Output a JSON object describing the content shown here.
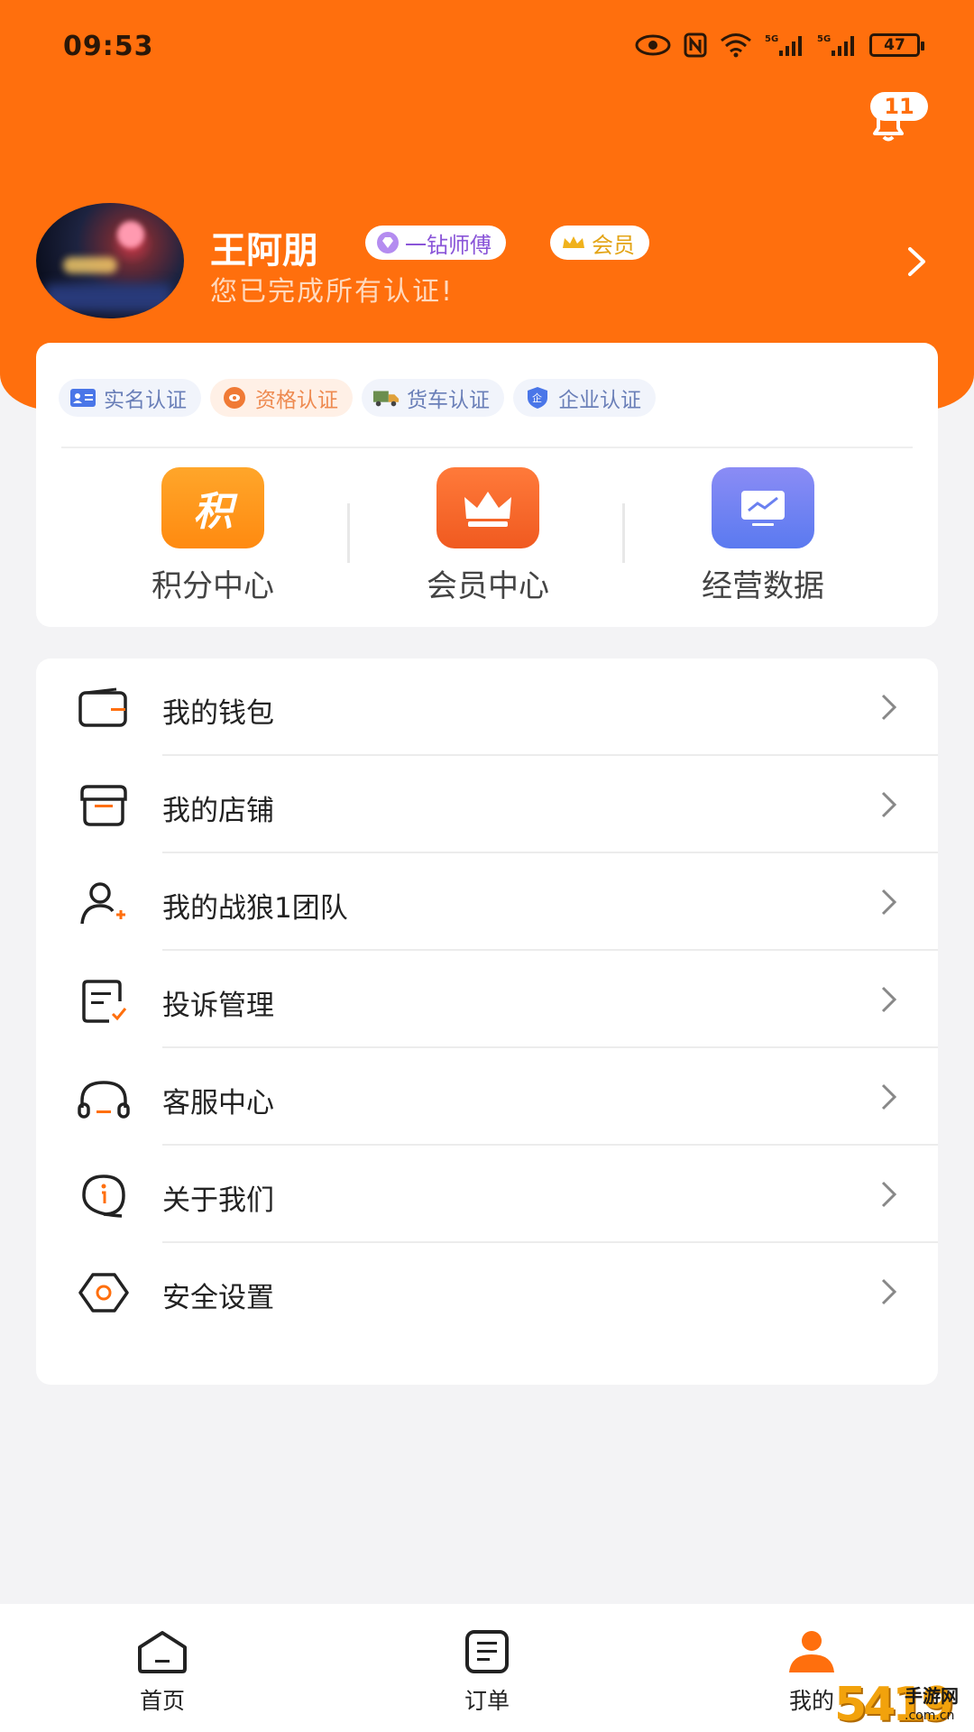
{
  "status_bar": {
    "time": "09:53",
    "network_label": "5G",
    "battery": "47"
  },
  "notifications": {
    "count": "11"
  },
  "profile": {
    "name": "王阿朋",
    "tags": [
      "一钻师傅",
      "会员"
    ],
    "subtitle": "您已完成所有认证!"
  },
  "certifications": [
    {
      "label": "实名认证",
      "icon": "id-card-icon",
      "active": false
    },
    {
      "label": "资格认证",
      "icon": "qualification-icon",
      "active": true
    },
    {
      "label": "货车认证",
      "icon": "truck-icon",
      "active": false
    },
    {
      "label": "企业认证",
      "icon": "enterprise-shield-icon",
      "active": false
    }
  ],
  "quick_entries": [
    {
      "label": "积分中心",
      "icon_text": "积",
      "icon": "points-icon"
    },
    {
      "label": "会员中心",
      "icon": "crown-icon"
    },
    {
      "label": "经营数据",
      "icon": "monitor-chart-icon"
    }
  ],
  "menu": [
    {
      "label": "我的钱包",
      "icon": "wallet-icon"
    },
    {
      "label": "我的店铺",
      "icon": "store-icon"
    },
    {
      "label": "我的战狼1团队",
      "icon": "team-add-icon"
    },
    {
      "label": "投诉管理",
      "icon": "complaint-icon"
    },
    {
      "label": "客服中心",
      "icon": "headset-icon"
    },
    {
      "label": "关于我们",
      "icon": "info-icon"
    },
    {
      "label": "安全设置",
      "icon": "security-settings-icon"
    }
  ],
  "tabbar": [
    {
      "label": "首页",
      "icon": "home-icon",
      "active": false
    },
    {
      "label": "订单",
      "icon": "order-icon",
      "active": false
    },
    {
      "label": "我的",
      "icon": "profile-icon",
      "active": true
    }
  ],
  "watermark": {
    "number": "5419",
    "name": "手游网",
    "domain": ".com.cn"
  },
  "colors": {
    "brand": "#ff6f0d",
    "background": "#f3f3f5"
  }
}
